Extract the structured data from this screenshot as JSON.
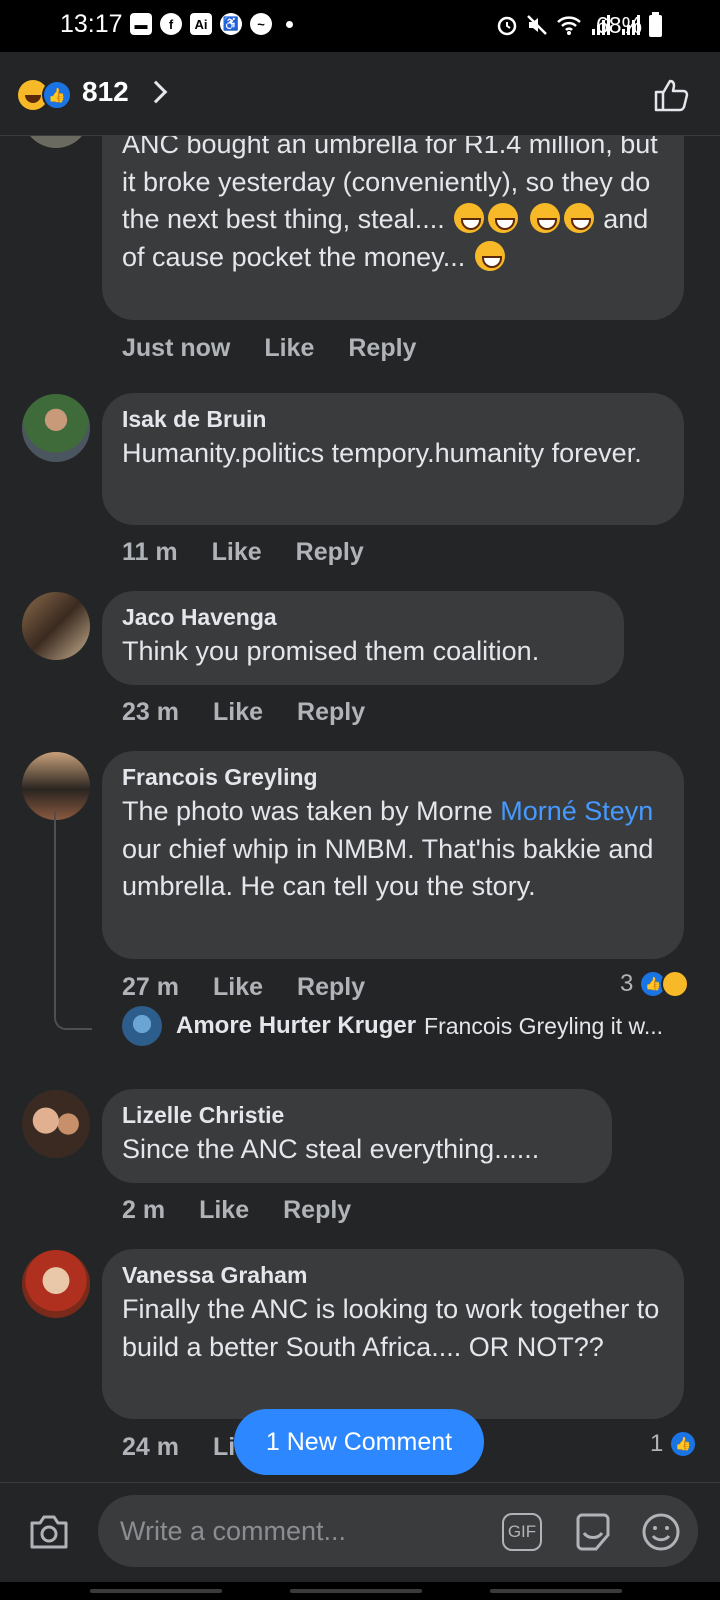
{
  "status_bar": {
    "time": "13:17",
    "battery": "68%",
    "left_icons": [
      "message-icon",
      "facebook-icon",
      "ai-icon",
      "accessibility-icon",
      "messenger-icon"
    ],
    "right_icons": [
      "alarm-icon",
      "mute-icon",
      "wifi-icon",
      "signal-icon",
      "signal-icon"
    ]
  },
  "header": {
    "reaction_count": "812"
  },
  "comments": [
    {
      "text_parts": [
        "ANC bought an umbrella for R1.4 million, but it broke yesterday (conveniently), so they do the next best thing, steal.... ",
        " and of cause pocket the money... "
      ],
      "time": "Just now",
      "like": "Like",
      "reply": "Reply"
    },
    {
      "author": "Isak de Bruin",
      "text": "Humanity.politics tempory.humanity forever.",
      "time": "11 m",
      "like": "Like",
      "reply": "Reply"
    },
    {
      "author": "Jaco Havenga",
      "text": "Think you promised them coalition.",
      "time": "23 m",
      "like": "Like",
      "reply": "Reply"
    },
    {
      "author": "Francois Greyling",
      "text_before": "The photo was taken by Morne ",
      "mention": "Morné Steyn",
      "text_after": " our chief whip in NMBM. That'his bakkie and umbrella. He can tell you the story.",
      "time": "27 m",
      "like": "Like",
      "reply": "Reply",
      "reaction_count": "3",
      "reply_preview": {
        "author": "Amore Hurter Kruger",
        "snippet": "Francois Greyling it w..."
      }
    },
    {
      "author": "Lizelle Christie",
      "text": "Since the ANC steal everything......",
      "time": "2 m",
      "like": "Like",
      "reply": "Reply"
    },
    {
      "author": "Vanessa Graham",
      "text": "Finally the ANC is looking to work together to build a better South Africa.... OR NOT??",
      "time": "24 m",
      "like": "Li",
      "reaction_count": "1"
    }
  ],
  "new_comment_button": "1 New Comment",
  "composer": {
    "placeholder": "Write a comment...",
    "gif_label": "GIF"
  },
  "colors": {
    "background": "#242526",
    "bubble": "#3a3b3c",
    "accent": "#2d88ff",
    "mention": "#4599ff",
    "secondary_text": "#b0b3b8"
  }
}
